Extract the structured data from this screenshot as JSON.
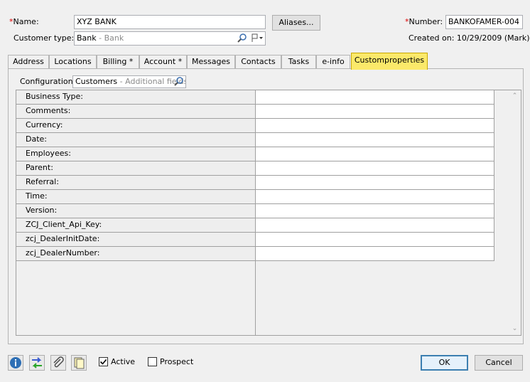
{
  "header": {
    "name_label": "Name:",
    "name_value": "XYZ BANK",
    "aliases_button": "Aliases...",
    "number_label": "Number:",
    "number_value": "BANKOFAMER-004",
    "customer_type_label": "Customer type:",
    "customer_type_value": "Bank",
    "customer_type_hint": "- Bank",
    "created_on": "Created on: 10/29/2009 (Mark)",
    "required_marker": "*"
  },
  "tabs": [
    {
      "label": "Address",
      "active": false
    },
    {
      "label": "Locations",
      "active": false
    },
    {
      "label": "Billing  *",
      "active": false
    },
    {
      "label": "Account *",
      "active": false
    },
    {
      "label": "Messages",
      "active": false
    },
    {
      "label": "Contacts",
      "active": false
    },
    {
      "label": "Tasks",
      "active": false
    },
    {
      "label": "e-info",
      "active": false
    },
    {
      "label": "Customproperties",
      "active": true
    }
  ],
  "configuration": {
    "label": "Configuration:",
    "value": "Customers",
    "hint": "- Additional fields"
  },
  "properties": [
    {
      "name": "Business Type:",
      "value": ""
    },
    {
      "name": "Comments:",
      "value": ""
    },
    {
      "name": "Currency:",
      "value": ""
    },
    {
      "name": "Date:",
      "value": ""
    },
    {
      "name": "Employees:",
      "value": ""
    },
    {
      "name": "Parent:",
      "value": ""
    },
    {
      "name": "Referral:",
      "value": ""
    },
    {
      "name": "Time:",
      "value": ""
    },
    {
      "name": "Version:",
      "value": ""
    },
    {
      "name": "ZCJ_Client_Api_Key:",
      "value": ""
    },
    {
      "name": "zcj_DealerInitDate:",
      "value": ""
    },
    {
      "name": "zcj_DealerNumber:",
      "value": ""
    }
  ],
  "footer": {
    "active_label": "Active",
    "active_checked": true,
    "prospect_label": "Prospect",
    "prospect_checked": false,
    "ok_button": "OK",
    "cancel_button": "Cancel"
  },
  "colors": {
    "active_tab": "#fbe96a",
    "required": "#dd0000",
    "info_icon": "#2e6fb5"
  }
}
